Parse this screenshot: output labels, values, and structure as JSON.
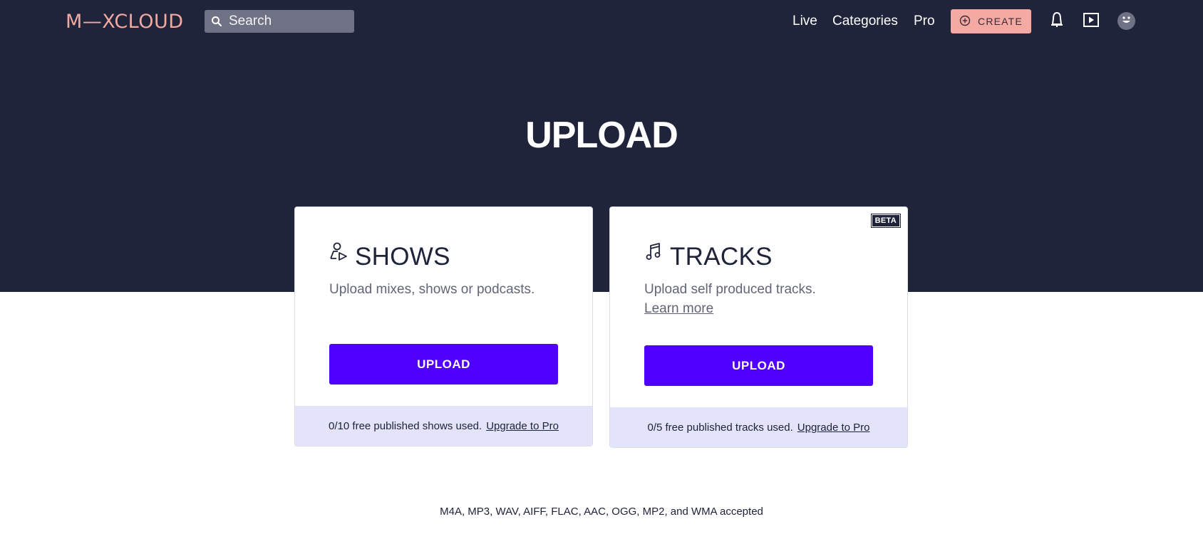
{
  "nav": {
    "logo": "M—XCLOUD",
    "search_placeholder": "Search",
    "links": [
      "Live",
      "Categories",
      "Pro"
    ],
    "create_label": "CREATE",
    "icons": [
      "search-icon",
      "bell-icon",
      "play-queue-icon",
      "avatar-face-icon",
      "plus-circle-icon"
    ]
  },
  "hero": {
    "title": "UPLOAD"
  },
  "cards": [
    {
      "title": "SHOWS",
      "icon": "person-play-icon",
      "description": "Upload mixes, shows or podcasts.",
      "button": "UPLOAD",
      "footer_text": "0/10 free published shows used.",
      "footer_link": "Upgrade to Pro"
    },
    {
      "title": "TRACKS",
      "icon": "music-note-icon",
      "badge": "BETA",
      "description": "Upload self produced tracks.",
      "learn_more": "Learn more",
      "button": "UPLOAD",
      "footer_text": "0/5 free published tracks used.",
      "footer_link": "Upgrade to Pro"
    }
  ],
  "formats_note": "M4A, MP3, WAV, AIFF, FLAC, AAC, OGG, MP2, and WMA accepted",
  "colors": {
    "header_bg": "#20243a",
    "brand_accent": "#f4aaa2",
    "upload_button": "#5000ff",
    "card_footer_bg": "#e3e3fb"
  }
}
